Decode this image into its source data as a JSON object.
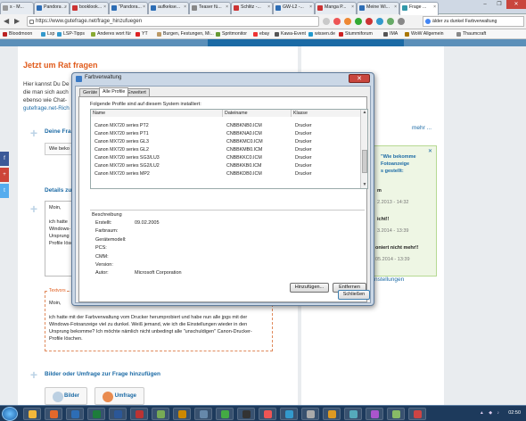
{
  "browser": {
    "tabs": [
      {
        "label": "s - M...",
        "active": false
      },
      {
        "label": "Pandora ...",
        "active": false
      },
      {
        "label": "booklook...",
        "active": false
      },
      {
        "label": "\"Pandora...",
        "active": false
      },
      {
        "label": "aufkekse...",
        "active": false
      },
      {
        "label": "Teaser fü...",
        "active": false
      },
      {
        "label": "Schlitz -...",
        "active": false
      },
      {
        "label": "GW-L2 -...",
        "active": false
      },
      {
        "label": "Manga P...",
        "active": false
      },
      {
        "label": "Meine Wi...",
        "active": false
      },
      {
        "label": "Frage ...",
        "active": true
      }
    ],
    "url": "https://www.gutefrage.net/frage_hinzufuegen",
    "search": "älder zu dunkel Farbverwaltung",
    "bookmarks": [
      "Bloodmoon",
      "Lsp",
      "LSP-Tipps",
      "Anderes wort für",
      "YT",
      "Burgen, Festungen, Mi...",
      "Spritmonitor",
      "ebay",
      "Kawa-Event",
      "wissen.de",
      "Stummiforum",
      "IMA",
      "WoW Allgemein",
      "Thaumcraft"
    ]
  },
  "site": {
    "heading": "Jetzt um Rat fragen",
    "intro": [
      "Hier kannst Du De",
      "die man sich auch",
      "ebenso wie Chat-",
      "gutefrage.net-Rich"
    ],
    "deine_frage": "Deine Fra",
    "question_short": "Wie beko",
    "details_head": "Details zu",
    "textarea_lines": [
      "Moin,",
      "ich hatte",
      "Windows-",
      "Ursprung",
      "Profile lösc"
    ],
    "textorig_label": "Textvors",
    "textorig_lines": [
      "Moin,",
      "ich hatte mit der Farbverwaltung vom Drucker herumprobiert und habe nun alle jpgs mit der",
      "Windows-Fotoanzeige viel zu dunkel. Weiß jemand, wie ich die Einstellungen wieder in den",
      "Ursprung bekomme? Ich möchte nämlich nicht unbedingt alle \"unschuldigen\" Canon-Drucker-",
      "Profile löschen."
    ],
    "bilder_head": "Bilder oder Umfrage zur Frage hinzufügen",
    "btn_bilder": "Bilder",
    "btn_umfrage": "Umfrage",
    "mehr": "mehr ...",
    "einstellungen": "nstellungen",
    "notif": {
      "l1": "\"Wie bekomme",
      "l2": "Fotoanzeige",
      "l3": "s gestellt:",
      "l4": "m",
      "l5": "2.2013 - 14:32",
      "l6": "icht!!",
      "l7": "3.2014 - 13:39",
      "l8": "oniert nicht mehr!!",
      "l9": "05.2014 - 13:39"
    },
    "share": [
      "f",
      "+",
      "t"
    ]
  },
  "dialog": {
    "title": "Farbverwaltung",
    "tabs": [
      "Geräte",
      "Alle Profile",
      "Erweitert"
    ],
    "installed_label": "Folgende Profile sind auf diesem System installiert:",
    "columns": [
      "Name",
      "Dateiname",
      "Klasse"
    ],
    "rows": [
      {
        "name": "Canon MX720 series PT2",
        "file": "CNBBKNB0.ICM",
        "klasse": "Drucker"
      },
      {
        "name": "Canon MX720 series PT1",
        "file": "CNBBKNA0.ICM",
        "klasse": "Drucker"
      },
      {
        "name": "Canon MX720 series GL3",
        "file": "CNBBKMC0.ICM",
        "klasse": "Drucker"
      },
      {
        "name": "Canon MX720 series GL2",
        "file": "CNBBKMB0.ICM",
        "klasse": "Drucker"
      },
      {
        "name": "Canon MX720 series SG3/LU3",
        "file": "CNBBKKC0.ICM",
        "klasse": "Drucker"
      },
      {
        "name": "Canon MX720 series SG2/LU2",
        "file": "CNBBKKB0.ICM",
        "klasse": "Drucker"
      },
      {
        "name": "Canon MX720 series MP2",
        "file": "CNBBKDB0.ICM",
        "klasse": "Drucker"
      }
    ],
    "description_title": "Beschreibung",
    "fields": [
      {
        "label": "Erstellt:",
        "value": "09.02.2005"
      },
      {
        "label": "Farbraum:",
        "value": ""
      },
      {
        "label": "Gerätemodell:",
        "value": ""
      },
      {
        "label": "PCS:",
        "value": ""
      },
      {
        "label": "CMM:",
        "value": ""
      },
      {
        "label": "Version:",
        "value": ""
      },
      {
        "label": "Autor:",
        "value": "Microsoft Corporation"
      }
    ],
    "btn_add": "Hinzufügen...",
    "btn_remove": "Entfernen",
    "btn_close": "Schließen"
  },
  "taskbar": {
    "clock": "02:50"
  },
  "colors": {
    "accent_orange": "#e05a1a",
    "link_blue": "#1b6aa5",
    "dialog_frame": "#cad7e6"
  }
}
